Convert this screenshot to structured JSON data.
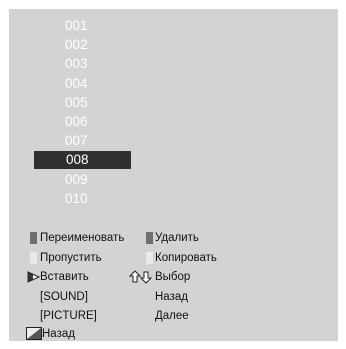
{
  "channel_list": {
    "items": [
      "001",
      "002",
      "003",
      "004",
      "005",
      "006",
      "007",
      "008",
      "009",
      "010"
    ],
    "selected": "008"
  },
  "legend": {
    "rename": "Переименовать",
    "delete": "Удалить",
    "skip": "Пропустить",
    "copy": "Копировать",
    "insert": "Вставить",
    "select": "Выбор",
    "sound": "[SOUND]",
    "back": "Назад",
    "picture": "[PICTURE]",
    "next": "Далее",
    "return": "Назад"
  },
  "colors": {
    "panel_bg": "#d3d3d3",
    "highlight_bg": "#2f2f2f",
    "channel_text": "#ffffff"
  },
  "icons": {
    "rename": "dark-square-icon",
    "delete": "dark-square-icon",
    "skip": "light-square-icon",
    "copy": "light-square-icon",
    "insert": "right-arrow-icon",
    "select": "up-down-arrows-icon",
    "return": "return-key-icon"
  }
}
